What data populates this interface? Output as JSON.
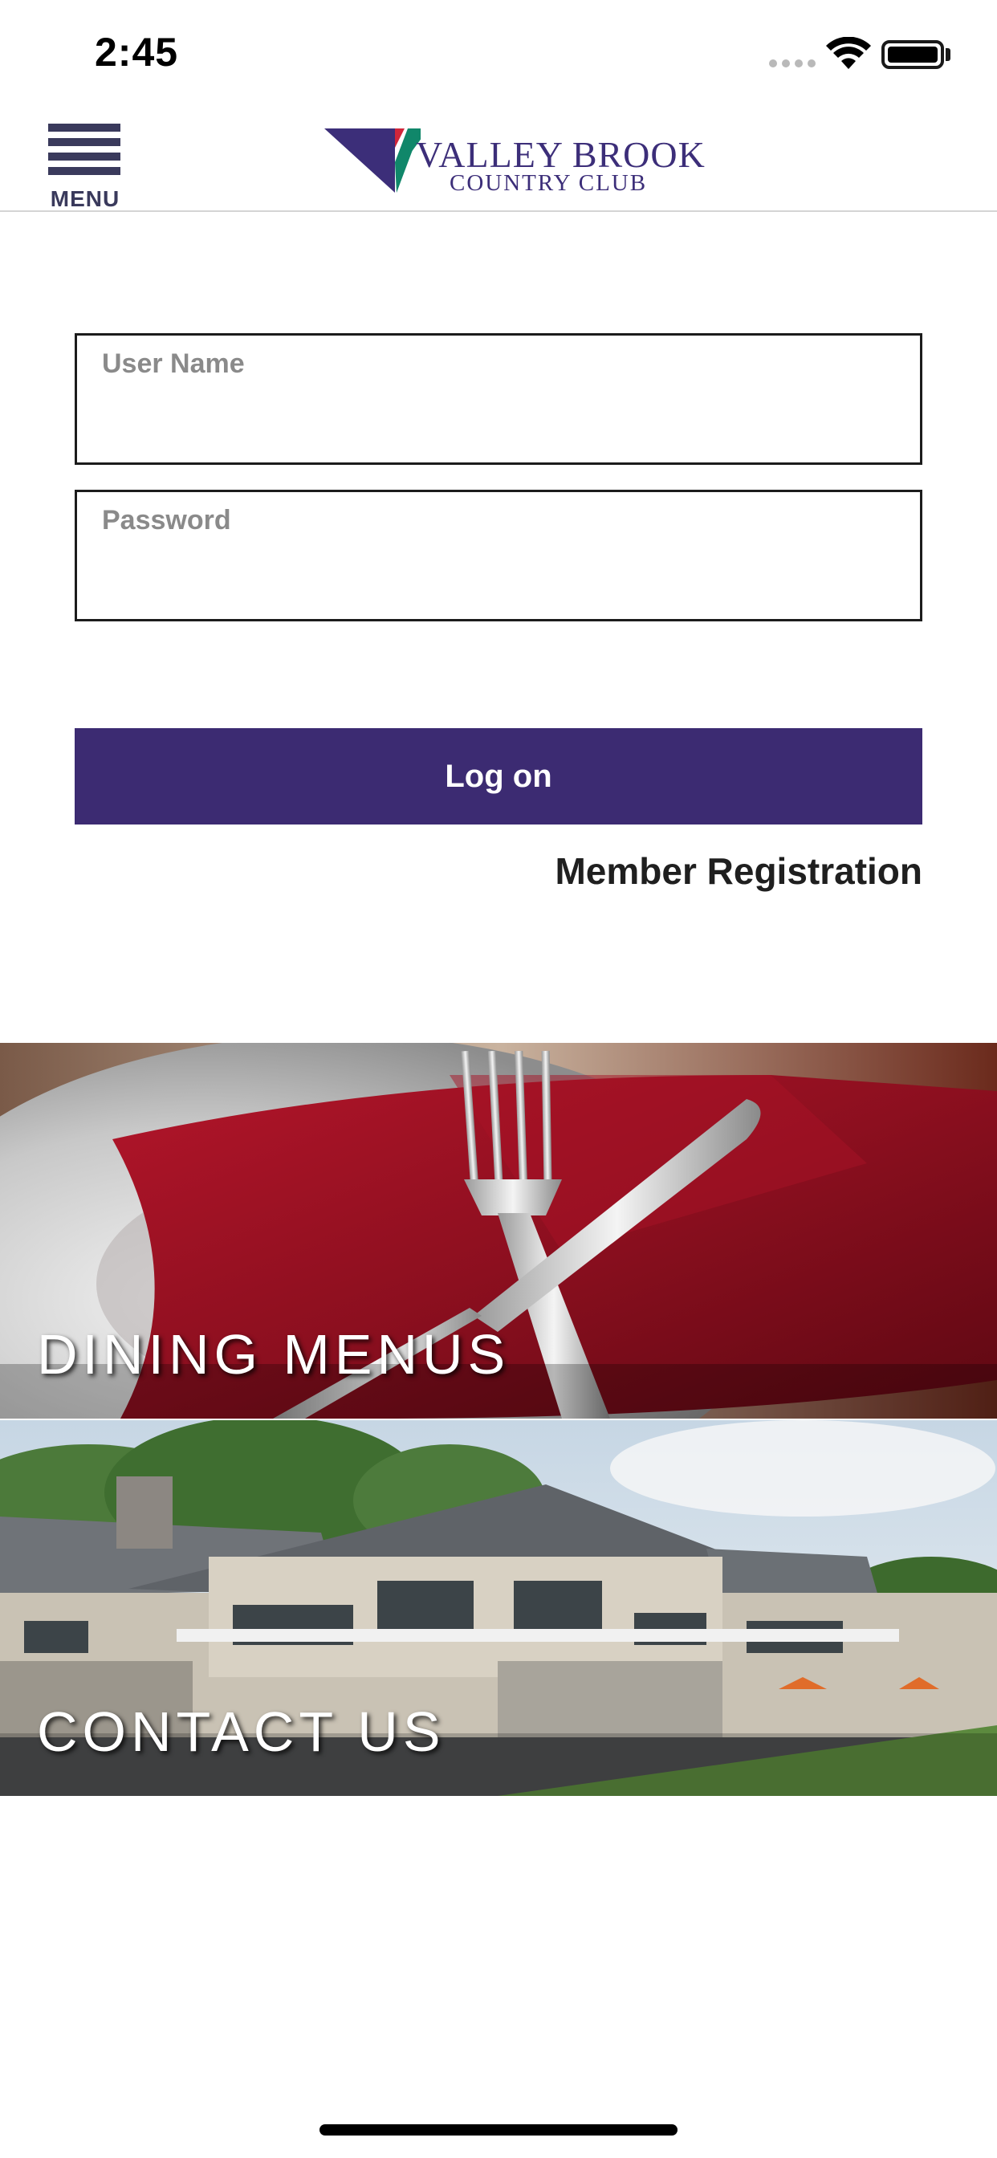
{
  "status_bar": {
    "time": "2:45",
    "icons": [
      "signal-dots-icon",
      "wifi-icon",
      "battery-icon"
    ]
  },
  "header": {
    "menu_label": "MENU",
    "logo": {
      "line1": "VALLEY BROOK",
      "line2": "COUNTRY CLUB",
      "colors": {
        "purple": "#3c2e79",
        "green": "#10876a",
        "red": "#d0263b"
      }
    }
  },
  "login_form": {
    "username_label": "User Name",
    "username_value": "",
    "password_label": "Password",
    "password_value": "",
    "logon_label": "Log on",
    "registration_label": "Member Registration"
  },
  "tiles": [
    {
      "label": "DINING MENUS",
      "icon": "dining-photo"
    },
    {
      "label": "CONTACT US",
      "icon": "clubhouse-photo"
    }
  ],
  "colors": {
    "accent": "#3c2b72",
    "text": "#1f1f1f",
    "field_label": "#8a8a8a"
  }
}
